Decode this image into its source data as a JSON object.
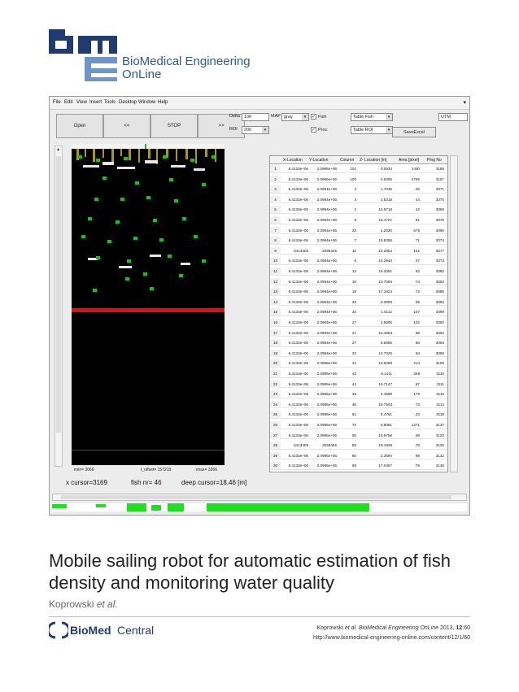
{
  "journal": {
    "logo_icon": "bme-logo",
    "name_line1": "BioMedical Engineering",
    "name_line2": "OnLine",
    "colors": {
      "navy": "#1f3b6f",
      "blue": "#2c5aa0"
    }
  },
  "app": {
    "menu": [
      "File",
      "Edit",
      "View",
      "Insert",
      "Tools",
      "Desktop",
      "Window",
      "Help"
    ],
    "buttons": {
      "open": "Open",
      "back": "<<",
      "stop": "STOP",
      "forward": ">>"
    },
    "controls": {
      "delta_label": "Delta",
      "delta_value": "100",
      "roi_label": "ROI",
      "roi_value": "200",
      "map_label": "MAP",
      "map_value": "gray",
      "fish_label": "Fish",
      "proc_label": "Proc",
      "table_fish": "Table Fish",
      "table_roi": "Table ROI",
      "save_excel": "SaveExcel",
      "utm": "UTM"
    },
    "table": {
      "headers": [
        "X-Location",
        "Y-Location",
        "Column",
        "Z- Location [m]",
        "Area [pixel]",
        "Ping No"
      ],
      "rows": [
        [
          "1",
          "6.4133e+06",
          "2.0995e+06",
          "101",
          "0.0934",
          "1400",
          "3188"
        ],
        [
          "2",
          "6.4133e+06",
          "2.0995e+06",
          "100",
          "0.6305",
          "4759",
          "3167"
        ],
        [
          "3",
          "6.4133e+06",
          "2.0994e+06",
          "4",
          "1.7046",
          "26",
          "3071"
        ],
        [
          "4",
          "6.4133e+06",
          "2.0994e+06",
          "3",
          "2.5218",
          "44",
          "3070"
        ],
        [
          "5",
          "6.4133e+06",
          "2.0994e+06",
          "2",
          "15.9718",
          "42",
          "3069"
        ],
        [
          "6",
          "6.4133e+06",
          "2.0994e+06",
          "8",
          "18.4701",
          "81",
          "3075"
        ],
        [
          "7",
          "6.4133e+06",
          "2.0994e+06",
          "23",
          "4.2030",
          "576",
          "3090"
        ],
        [
          "8",
          "6.4133e+06",
          "2.0994e+06",
          "7",
          "16.8355",
          "71",
          "3074"
        ],
        [
          "9",
          "6413305",
          "2099445",
          "10",
          "14.2804",
          "151",
          "3077"
        ],
        [
          "10",
          "6.4133e+06",
          "2.0994e+06",
          "6",
          "15.2944",
          "37",
          "3073"
        ],
        [
          "11",
          "6.4133e+06",
          "2.0994e+06",
          "13",
          "16.2051",
          "62",
          "3080"
        ],
        [
          "12",
          "6.4133e+06",
          "2.0994e+06",
          "16",
          "13.7066",
          "74",
          "3083"
        ],
        [
          "13",
          "6.4133e+06",
          "2.0994e+06",
          "18",
          "17.1624",
          "72",
          "3085"
        ],
        [
          "14",
          "6.4133e+06",
          "2.0994e+06",
          "26",
          "5.3809",
          "95",
          "3093"
        ],
        [
          "15",
          "6.4133e+06",
          "2.0994e+06",
          "32",
          "1.6112",
          "107",
          "3099"
        ],
        [
          "16",
          "6.4133e+06",
          "2.0994e+06",
          "27",
          "2.5605",
          "102",
          "3094"
        ],
        [
          "17",
          "6.4133e+06",
          "2.0994e+06",
          "27",
          "16.4853",
          "89",
          "3094"
        ],
        [
          "18",
          "6.4133e+06",
          "2.0994e+06",
          "27",
          "8.5695",
          "66",
          "3094"
        ],
        [
          "19",
          "6.4133e+06",
          "2.0994e+06",
          "32",
          "12.7025",
          "63",
          "3099"
        ],
        [
          "20",
          "6.4133e+06",
          "2.0995e+06",
          "41",
          "16.9289",
          "214",
          "3108"
        ],
        [
          "21",
          "6.4133e+06",
          "2.0995e+06",
          "43",
          "6.1411",
          "259",
          "3110"
        ],
        [
          "22",
          "6.4133e+06",
          "2.0995e+06",
          "44",
          "15.7147",
          "67",
          "3111"
        ],
        [
          "23",
          "6.4133e+06",
          "2.0995e+06",
          "48",
          "4.4599",
          "179",
          "3115"
        ],
        [
          "24",
          "6.4133e+06",
          "2.0995e+06",
          "46",
          "18.7503",
          "73",
          "3113"
        ],
        [
          "25",
          "6.4133e+06",
          "2.0995e+06",
          "51",
          "2.4751",
          "23",
          "3118"
        ],
        [
          "26",
          "6.4133e+06",
          "2.0995e+06",
          "70",
          "5.8081",
          "1271",
          "3137"
        ],
        [
          "27",
          "6.4133e+06",
          "2.0995e+06",
          "55",
          "16.9756",
          "69",
          "3122"
        ],
        [
          "28",
          "6413309",
          "2099455",
          "59",
          "19.1939",
          "78",
          "3126"
        ],
        [
          "29",
          "6.4133e+06",
          "2.0995e+06",
          "65",
          "2.3594",
          "89",
          "3132"
        ],
        [
          "30",
          "6.4133e+06",
          "2.0995e+06",
          "69",
          "17.0457",
          "79",
          "3136"
        ]
      ]
    },
    "stats": {
      "imin": "imin= 3066",
      "t_offset": "t_offset= 157210",
      "imax": "imax= 3266",
      "x_cursor": "x cursor=3169",
      "fish_nr": "fish nr= 46",
      "deep_cursor": "deep cursor=18.46 [m]"
    },
    "colors": {
      "sonar_bg": "#000000",
      "fish": "#17c21b",
      "bottom_line": "#e01010",
      "strip": "#21e021"
    }
  },
  "paper": {
    "title": "Mobile sailing robot for automatic estimation of fish density and monitoring water quality",
    "authors_name": "Koprowski",
    "authors_etal": "et al.",
    "publisher_logo_icon": "biomed-central-logo",
    "publisher_bold": "BioMed",
    "publisher_light": "Central",
    "citation_author": "Koprowski",
    "citation_etal": "et al.",
    "citation_journal": "BioMedical Engineering OnLine",
    "citation_year": "2013,",
    "citation_volume": "12",
    "citation_pages": ":60",
    "url": "http://www.biomedical-engineering-online.com/content/12/1/60"
  }
}
